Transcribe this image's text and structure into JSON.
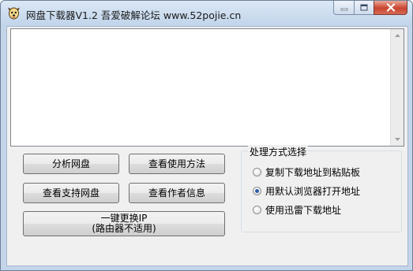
{
  "window": {
    "title": "网盘下载器V1.2    吾爱破解论坛 www.52pojie.cn"
  },
  "buttons": {
    "analyze": "分析网盘",
    "usage": "查看使用方法",
    "supported": "查看支持网盘",
    "author": "查看作者信息",
    "change_ip_line1": "一键更换IP",
    "change_ip_line2": "(路由器不适用)"
  },
  "options": {
    "group_title": "处理方式选择",
    "items": [
      {
        "label": "复制下载地址到粘贴板",
        "checked": false
      },
      {
        "label": "用默认浏览器打开地址",
        "checked": true
      },
      {
        "label": "使用迅雷下载地址",
        "checked": false
      }
    ]
  },
  "icons": {
    "app": "puppy-app-icon",
    "minimize": "minimize-icon",
    "maximize": "maximize-icon",
    "close": "close-icon",
    "scroll_up": "scroll-up-icon",
    "scroll_down": "scroll-down-icon"
  },
  "colors": {
    "titlebar": "#c4d5ea",
    "close_button": "#c9442e",
    "client_bg": "#f0f0f0"
  }
}
